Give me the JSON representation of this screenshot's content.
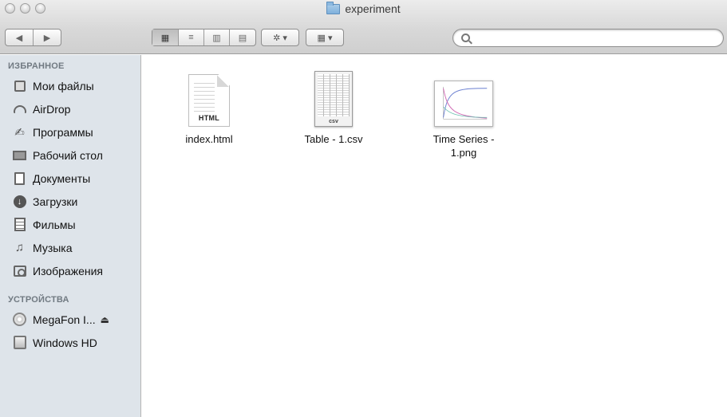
{
  "window": {
    "title": "experiment"
  },
  "toolbar": {
    "back_glyph": "◀",
    "forward_glyph": "▶",
    "view_icons_glyph": "▦",
    "view_list_glyph": "≡",
    "view_columns_glyph": "▥",
    "view_coverflow_glyph": "▤",
    "action_glyph": "✲ ▾",
    "arrange_glyph": "▦ ▾",
    "search_placeholder": ""
  },
  "sidebar": {
    "favorites_header": "ИЗБРАННОЕ",
    "favorites": [
      {
        "label": "Мои файлы",
        "icon": "all-files-icon"
      },
      {
        "label": "AirDrop",
        "icon": "airdrop-icon"
      },
      {
        "label": "Программы",
        "icon": "applications-icon"
      },
      {
        "label": "Рабочий стол",
        "icon": "desktop-icon"
      },
      {
        "label": "Документы",
        "icon": "documents-icon"
      },
      {
        "label": "Загрузки",
        "icon": "downloads-icon"
      },
      {
        "label": "Фильмы",
        "icon": "movies-icon"
      },
      {
        "label": "Музыка",
        "icon": "music-icon"
      },
      {
        "label": "Изображения",
        "icon": "pictures-icon"
      }
    ],
    "devices_header": "УСТРОЙСТВА",
    "devices": [
      {
        "label": "MegaFon I...",
        "icon": "disc-icon",
        "eject": "⏏"
      },
      {
        "label": "Windows HD",
        "icon": "hard-drive-icon"
      }
    ]
  },
  "files": [
    {
      "name": "index.html",
      "type": "html",
      "badge": "HTML"
    },
    {
      "name": "Table - 1.csv",
      "type": "csv",
      "badge": "csv"
    },
    {
      "name": "Time Series -\n1.png",
      "type": "png"
    }
  ]
}
